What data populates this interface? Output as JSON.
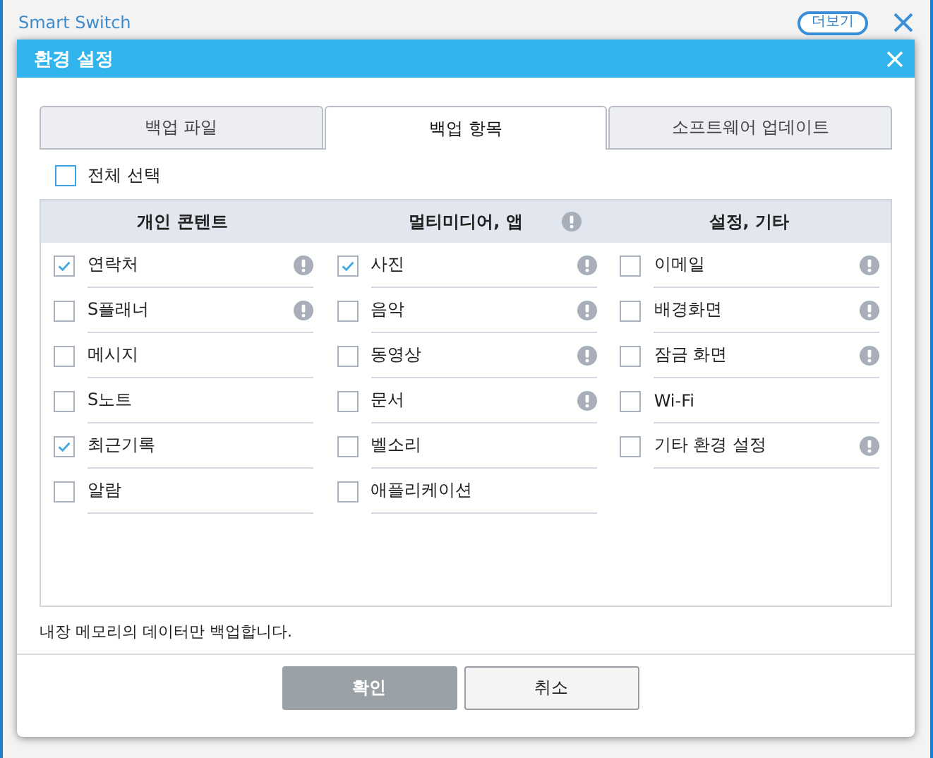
{
  "app": {
    "title": "Smart Switch",
    "more_button": "더보기"
  },
  "dialog": {
    "title": "환경 설정",
    "tabs": [
      {
        "label": "백업 파일",
        "selected": false
      },
      {
        "label": "백업 항목",
        "selected": true
      },
      {
        "label": "소프트웨어 업데이트",
        "selected": false
      }
    ],
    "select_all": {
      "label": "전체 선택",
      "checked": false
    },
    "columns": [
      {
        "title": "개인 콘텐트",
        "info": false,
        "items": [
          {
            "label": "연락처",
            "checked": true,
            "info": true
          },
          {
            "label": "S플래너",
            "checked": false,
            "info": true
          },
          {
            "label": "메시지",
            "checked": false,
            "info": false
          },
          {
            "label": "S노트",
            "checked": false,
            "info": false
          },
          {
            "label": "최근기록",
            "checked": true,
            "info": false
          },
          {
            "label": "알람",
            "checked": false,
            "info": false
          }
        ]
      },
      {
        "title": "멀티미디어, 앱",
        "info": true,
        "items": [
          {
            "label": "사진",
            "checked": true,
            "info": true
          },
          {
            "label": "음악",
            "checked": false,
            "info": true
          },
          {
            "label": "동영상",
            "checked": false,
            "info": true
          },
          {
            "label": "문서",
            "checked": false,
            "info": true
          },
          {
            "label": "벨소리",
            "checked": false,
            "info": false
          },
          {
            "label": "애플리케이션",
            "checked": false,
            "info": false
          }
        ]
      },
      {
        "title": "설정, 기타",
        "info": false,
        "items": [
          {
            "label": "이메일",
            "checked": false,
            "info": true
          },
          {
            "label": "배경화면",
            "checked": false,
            "info": true
          },
          {
            "label": "잠금 화면",
            "checked": false,
            "info": true
          },
          {
            "label": "Wi-Fi",
            "checked": false,
            "info": false
          },
          {
            "label": "기타 환경 설정",
            "checked": false,
            "info": true
          }
        ]
      }
    ],
    "note": "내장 메모리의 데이터만 백업합니다.",
    "buttons": [
      {
        "label": "확인",
        "disabled": true
      },
      {
        "label": "취소",
        "disabled": false
      }
    ]
  }
}
